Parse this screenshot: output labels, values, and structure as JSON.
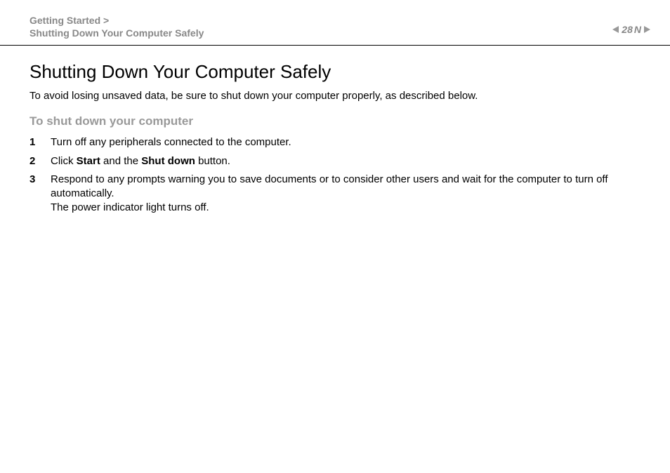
{
  "header": {
    "breadcrumb_line1": "Getting Started >",
    "breadcrumb_line2": "Shutting Down Your Computer Safely",
    "page_number": "28",
    "n_label": "N"
  },
  "main": {
    "title": "Shutting Down Your Computer Safely",
    "intro": "To avoid losing unsaved data, be sure to shut down your computer properly, as described below.",
    "subheading": "To shut down your computer",
    "steps": [
      {
        "num": "1",
        "text_html": "Turn off any peripherals connected to the computer."
      },
      {
        "num": "2",
        "text_html": "Click <b>Start</b> and the <b>Shut down</b> button."
      },
      {
        "num": "3",
        "text_html": "Respond to any prompts warning you to save documents or to consider other users and wait for the computer to turn off automatically.<br>The power indicator light turns off."
      }
    ]
  }
}
